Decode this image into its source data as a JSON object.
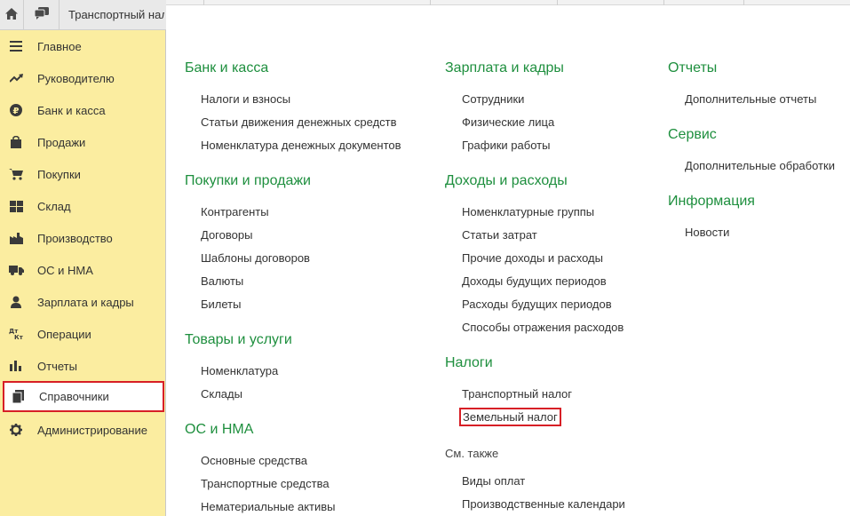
{
  "topbar": {
    "home_icon": "home-icon",
    "chat_icon": "chat-icon",
    "tab_title": "Транспортный налог"
  },
  "sidebar": {
    "items": [
      {
        "label": "Главное",
        "icon": "menu-lines-icon"
      },
      {
        "label": "Руководителю",
        "icon": "trend-up-icon"
      },
      {
        "label": "Банк и касса",
        "icon": "ruble-icon"
      },
      {
        "label": "Продажи",
        "icon": "shopping-bag-icon"
      },
      {
        "label": "Покупки",
        "icon": "cart-icon"
      },
      {
        "label": "Склад",
        "icon": "warehouse-grid-icon"
      },
      {
        "label": "Производство",
        "icon": "factory-icon"
      },
      {
        "label": "ОС и НМА",
        "icon": "truck-icon"
      },
      {
        "label": "Зарплата и кадры",
        "icon": "person-icon"
      },
      {
        "label": "Операции",
        "icon": "dt-kt-icon"
      },
      {
        "label": "Отчеты",
        "icon": "bar-chart-icon"
      },
      {
        "label": "Справочники",
        "icon": "books-icon",
        "active": true
      },
      {
        "label": "Администрирование",
        "icon": "gear-icon"
      }
    ]
  },
  "content": {
    "col1": {
      "bank": {
        "title": "Банк и касса",
        "links": [
          "Налоги и взносы",
          "Статьи движения денежных средств",
          "Номенклатура денежных документов"
        ]
      },
      "trade": {
        "title": "Покупки и продажи",
        "links": [
          "Контрагенты",
          "Договоры",
          "Шаблоны договоров",
          "Валюты",
          "Билеты"
        ]
      },
      "goods": {
        "title": "Товары и услуги",
        "links": [
          "Номенклатура",
          "Склады"
        ]
      },
      "assets": {
        "title": "ОС и НМА",
        "links": [
          "Основные средства",
          "Транспортные средства",
          "Нематериальные активы"
        ]
      }
    },
    "col2": {
      "salary": {
        "title": "Зарплата и кадры",
        "links": [
          "Сотрудники",
          "Физические лица",
          "Графики работы"
        ]
      },
      "income": {
        "title": "Доходы и расходы",
        "links": [
          "Номенклатурные группы",
          "Статьи затрат",
          "Прочие доходы и расходы",
          "Доходы будущих периодов",
          "Расходы будущих периодов",
          "Способы отражения расходов"
        ]
      },
      "taxes": {
        "title": "Налоги",
        "links": [
          "Транспортный налог",
          "Земельный налог"
        ]
      },
      "see_also": {
        "title": "См. также",
        "links": [
          "Виды оплат",
          "Производственные календари"
        ]
      }
    },
    "col3": {
      "reports": {
        "title": "Отчеты",
        "links": [
          "Дополнительные отчеты"
        ]
      },
      "service": {
        "title": "Сервис",
        "links": [
          "Дополнительные обработки"
        ]
      },
      "info": {
        "title": "Информация",
        "links": [
          "Новости"
        ]
      }
    }
  },
  "colors": {
    "sidebar_bg": "#fbeda0",
    "section_title": "#1e8f3e",
    "highlight_border": "#d71f26"
  }
}
